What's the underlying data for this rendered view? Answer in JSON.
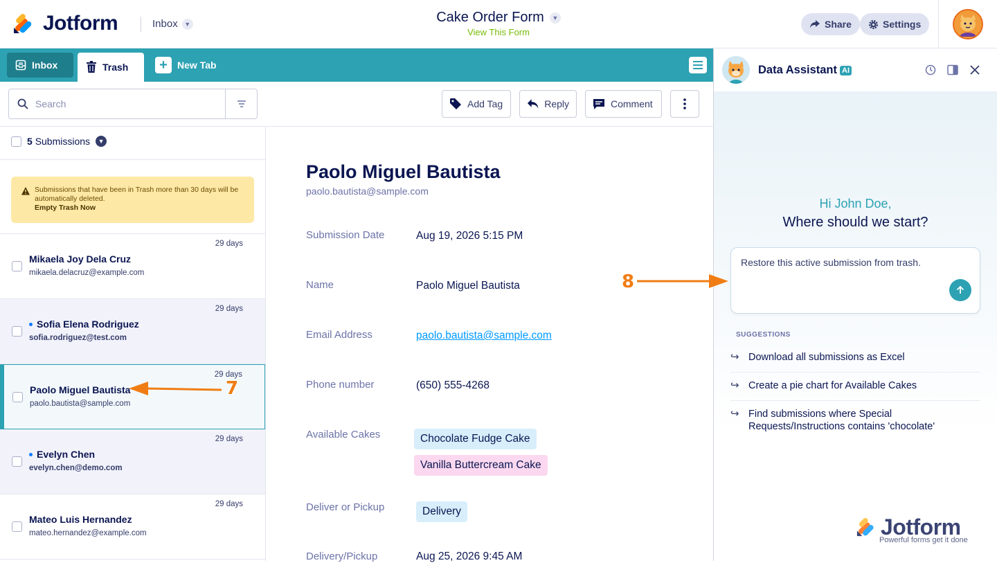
{
  "header": {
    "logo_text": "Jotform",
    "inbox_label": "Inbox",
    "form_title": "Cake Order Form",
    "view_form": "View This Form",
    "share_label": "Share",
    "settings_label": "Settings"
  },
  "tabs": {
    "inbox": "Inbox",
    "trash": "Trash",
    "new_tab": "New Tab"
  },
  "toolbar": {
    "search_placeholder": "Search",
    "add_tag": "Add Tag",
    "reply": "Reply",
    "comment": "Comment"
  },
  "list": {
    "count_number": "5",
    "count_label": "Submissions",
    "warning_text": "Submissions that have been in Trash more than 30 days will be automatically deleted.",
    "warning_action": "Empty Trash Now",
    "rows": [
      {
        "name": "Mikaela Joy Dela Cruz",
        "email": "mikaela.delacruz@example.com",
        "days": "29 days"
      },
      {
        "name": "Sofia Elena Rodriguez",
        "email": "sofia.rodriguez@test.com",
        "days": "29 days"
      },
      {
        "name": "Paolo Miguel Bautista",
        "email": "paolo.bautista@sample.com",
        "days": "29 days"
      },
      {
        "name": "Evelyn Chen",
        "email": "evelyn.chen@demo.com",
        "days": "29 days"
      },
      {
        "name": "Mateo Luis Hernandez",
        "email": "mateo.hernandez@example.com",
        "days": "29 days"
      }
    ]
  },
  "detail": {
    "name": "Paolo Miguel Bautista",
    "email": "paolo.bautista@sample.com",
    "fields": {
      "submission_date_label": "Submission Date",
      "submission_date_value": "Aug 19, 2026 5:15 PM",
      "name_label": "Name",
      "name_value": "Paolo Miguel Bautista",
      "email_label": "Email Address",
      "email_value": "paolo.bautista@sample.com",
      "phone_label": "Phone number",
      "phone_value": "(650) 555-4268",
      "cakes_label": "Available Cakes",
      "cakes": [
        "Chocolate Fudge Cake",
        "Vanilla Buttercream Cake"
      ],
      "deliver_label": "Deliver or Pickup",
      "deliver_value": "Delivery",
      "delivery_date_label": "Delivery/Pickup",
      "delivery_date_value": "Aug 25, 2026 9:45 AM"
    }
  },
  "assistant": {
    "title": "Data Assistant",
    "badge": "AI",
    "greeting": "Hi John Doe,",
    "question": "Where should we start?",
    "prompt_text": "Restore this active submission from trash.",
    "suggestions_header": "SUGGESTIONS",
    "suggestions": [
      "Download all submissions as Excel",
      "Create a pie chart for Available Cakes",
      "Find submissions where Special Requests/Instructions contains 'chocolate'"
    ],
    "watermark": "Jotform",
    "watermark_sub": "Powerful forms get it done"
  },
  "annotations": {
    "seven": "7",
    "eight": "8"
  },
  "colors": {
    "teal": "#2da2b3",
    "navy": "#0a1551",
    "warning_bg": "#fde8a5",
    "annotation_orange": "#f07d14",
    "chip_blue": "#d8eefb",
    "chip_pink": "#fbd8ef",
    "view_form_green": "#78bb07"
  }
}
